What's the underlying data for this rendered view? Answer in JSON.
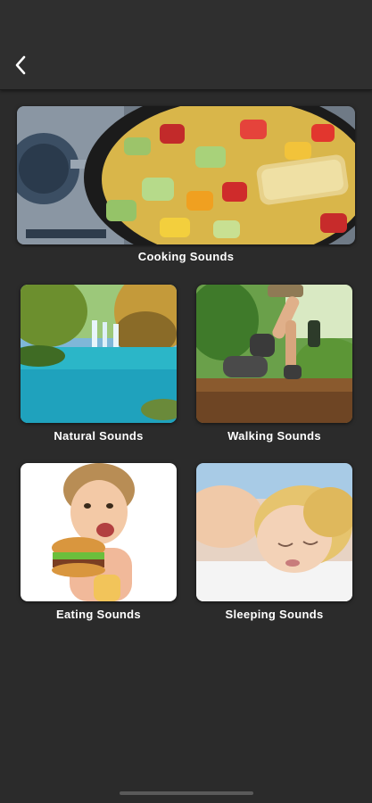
{
  "header": {
    "back_icon": "chevron-left-icon"
  },
  "categories": [
    {
      "id": "cooking",
      "label": "Cooking Sounds"
    },
    {
      "id": "natural",
      "label": "Natural Sounds"
    },
    {
      "id": "walking",
      "label": "Walking Sounds"
    },
    {
      "id": "eating",
      "label": "Eating Sounds"
    },
    {
      "id": "sleeping",
      "label": "Sleeping Sounds"
    }
  ],
  "colors": {
    "background": "#2b2b2b",
    "topbar": "#2f2f2f",
    "text": "#ffffff"
  }
}
